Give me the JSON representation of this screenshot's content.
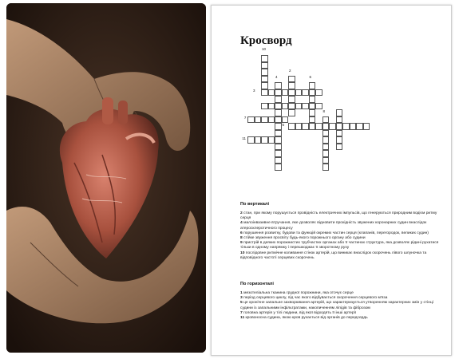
{
  "crossword": {
    "title": "Кросворд",
    "cell_numbers": [
      "10",
      "4",
      "2",
      "6",
      "3",
      "1",
      "8",
      "7",
      "5",
      "11"
    ],
    "vertical_heading": "По вертикалі",
    "vertical_clues": [
      {
        "n": "2",
        "t": "стан, при якому порушується провідність електричних імпульсів, що генеруються природним водієм ритму серця"
      },
      {
        "n": "4",
        "t": "малоінвазивне втручання, яке дозволяє відновити прохідність звужених коронарних судин внаслідок атеросклеротичного процесу"
      },
      {
        "n": "6",
        "t": "порушення розвитку, будови та функцій окремих частин серця (клапанів, перегородок, великих судин)"
      },
      {
        "n": "8",
        "t": "стійке звуження просвіту будь-якого порожнього органу або судини"
      },
      {
        "n": "9",
        "t": "пристрій в деяких порожнистих трубчастих органах або її частинах структура, яка дозволяє рідині рухатися тільки в одному напрямку і перешкоджає її зворотному руху"
      },
      {
        "n": "10",
        "t": "послідовне ритмічне коливання стінок артерій, що виникає внаслідок скорочень лівого шлуночка та відповідного частоті серцевих скорочень"
      }
    ],
    "horizontal_heading": "По горизонталі",
    "horizontal_clues": [
      {
        "n": "1",
        "t": "мезотеліальна тканина грудної порожнини, яка оточує серце"
      },
      {
        "n": "3",
        "t": "період серцевого циклу, під час якого відбувається скорочення серцевого м'яза"
      },
      {
        "n": "5",
        "t": "це хронічне запальне захворювання артерій, що характеризується утворенням характерних змін у стінці судини із запальними інфільтратами, накопиченням ліпідів та фіброзом"
      },
      {
        "n": "7",
        "t": "головна артерія у тілі людини, від якої відходять її інші артерії"
      },
      {
        "n": "11",
        "t": "кровоносна судина, якою кров рухається від органів до передсердь"
      }
    ]
  },
  "image": {
    "subject-icon": "hands-holding-heart-icon"
  }
}
